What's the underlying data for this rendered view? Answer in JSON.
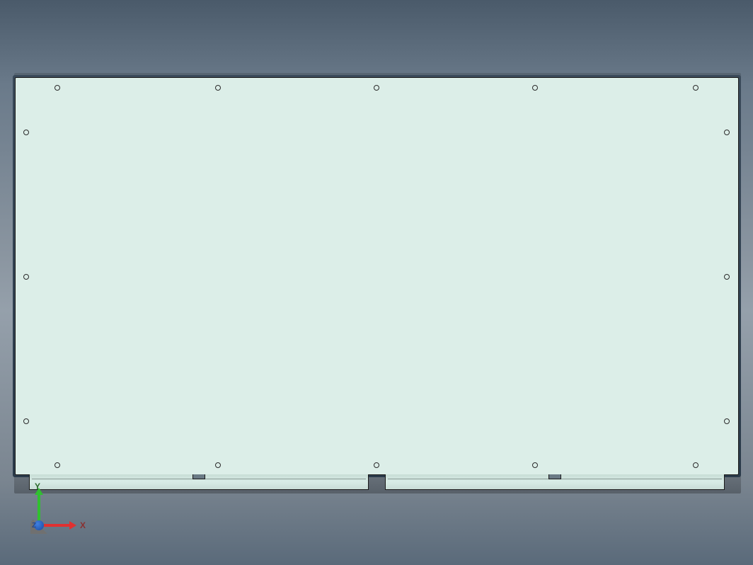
{
  "viewport": {
    "background_gradient": [
      "#4a5a6a",
      "#8a95a0",
      "#5a6a7a"
    ]
  },
  "model": {
    "panel_color": "#dceee8",
    "edge_color": "#1a1a1a",
    "hole_count": 16
  },
  "triad": {
    "x_label": "X",
    "y_label": "Y",
    "z_label": "Z",
    "x_color": "#e03030",
    "y_color": "#30c030",
    "z_color": "#3060d0"
  }
}
